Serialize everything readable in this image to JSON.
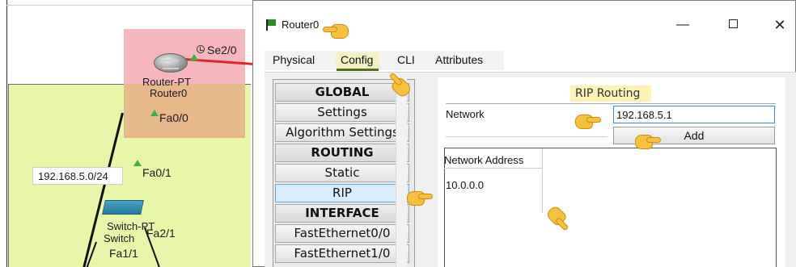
{
  "canvas": {
    "interface_se": "Se2/0",
    "router_type": "Router-PT",
    "router_name": "Router0",
    "interface_fa00": "Fa0/0",
    "network_label": "192.168.5.0/24",
    "interface_fa01": "Fa0/1",
    "switch_type": "Switch-PT",
    "switch_name": "Switch",
    "interface_fa20": "Fa2/1",
    "interface_fa11": "Fa1/1"
  },
  "window": {
    "title": "Router0",
    "minimize_glyph": "—",
    "close_glyph": "✕"
  },
  "tabs": {
    "physical": "Physical",
    "config": "Config",
    "cli": "CLI",
    "attributes": "Attributes"
  },
  "nav": {
    "items": [
      {
        "label": "GLOBAL",
        "type": "header"
      },
      {
        "label": "Settings",
        "type": "item"
      },
      {
        "label": "Algorithm Settings",
        "type": "item"
      },
      {
        "label": "ROUTING",
        "type": "header"
      },
      {
        "label": "Static",
        "type": "item"
      },
      {
        "label": "RIP",
        "type": "selected"
      },
      {
        "label": "INTERFACE",
        "type": "header"
      },
      {
        "label": "FastEthernet0/0",
        "type": "item"
      },
      {
        "label": "FastEthernet1/0",
        "type": "item"
      }
    ],
    "scroll_up_glyph": "▲"
  },
  "rip": {
    "title": "RIP Routing",
    "network_label": "Network",
    "network_value": "192.168.5.1",
    "add_label": "Add",
    "list_header": "Network Address",
    "list_rows": [
      "10.0.0.0"
    ]
  }
}
